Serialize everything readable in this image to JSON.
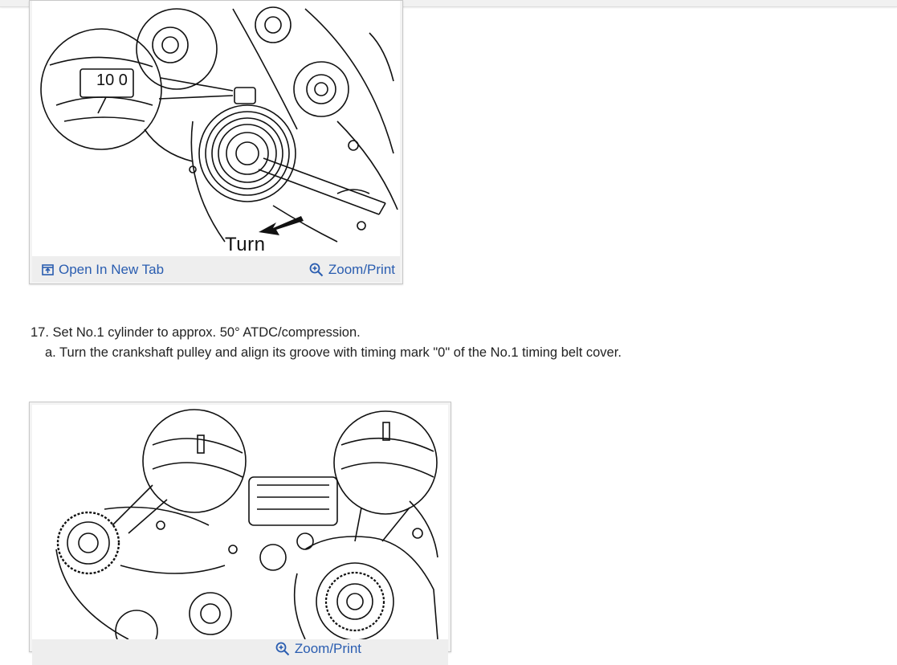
{
  "figure1": {
    "turn_label": "Turn",
    "dial_text": "10 0",
    "open_tab_label": "Open In New Tab",
    "zoom_label": "Zoom/Print"
  },
  "step": {
    "main": "17. Set No.1 cylinder to approx. 50° ATDC/compression.",
    "sub": "a. Turn the crankshaft pulley and align its groove with timing mark \"0\" of the No.1 timing belt cover."
  },
  "figure2": {
    "zoom_label": "Zoom/Print"
  },
  "colors": {
    "link": "#2a5db0",
    "toolbar": "#eeeeee",
    "border": "#c8c8c8"
  },
  "icons": [
    "open-new-tab-icon",
    "zoom-in-icon"
  ]
}
